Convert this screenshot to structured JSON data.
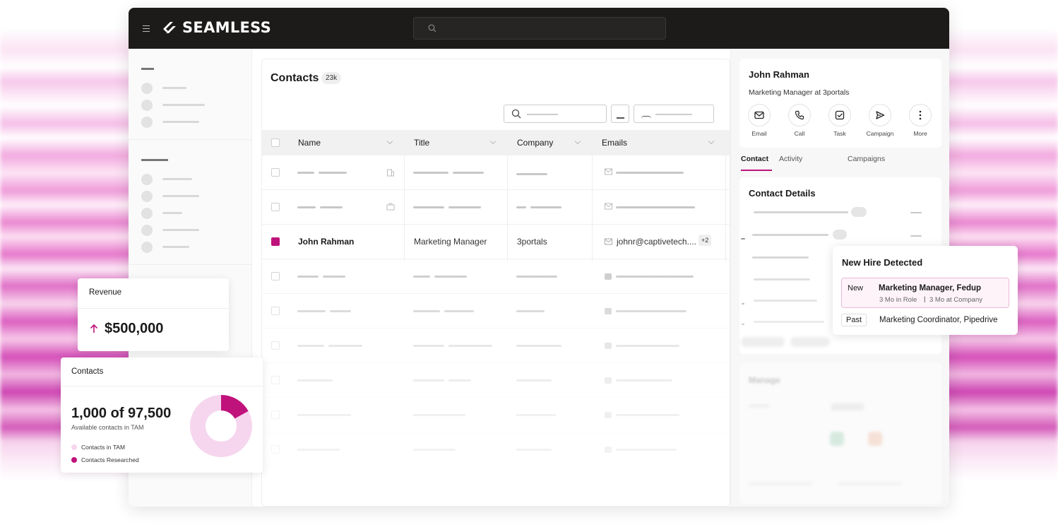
{
  "brand": {
    "name": "SEAMLESS",
    "accent": "#c0127b"
  },
  "topbar": {
    "search_icon": "search-icon",
    "menu_icon": "hamburger-icon"
  },
  "contacts_table": {
    "title": "Contacts",
    "count_badge": "23k",
    "columns": [
      "Name",
      "Title",
      "Company",
      "Emails"
    ],
    "highlighted_row": {
      "name": "John Rahman",
      "title": "Marketing Manager",
      "company": "3portals",
      "email": "johnr@captivetech....",
      "email_extra": "+2",
      "selected": true
    }
  },
  "profile": {
    "name": "John Rahman",
    "subtitle": "Marketing Manager at 3portals",
    "actions": [
      {
        "label": "Email",
        "icon": "mail-icon"
      },
      {
        "label": "Call",
        "icon": "phone-icon"
      },
      {
        "label": "Task",
        "icon": "task-check-icon"
      },
      {
        "label": "Campaign",
        "icon": "send-icon"
      },
      {
        "label": "More",
        "icon": "more-vertical-icon"
      }
    ],
    "tabs": [
      "Contact",
      "Activity",
      "Campaigns"
    ],
    "active_tab": "Contact"
  },
  "contact_details": {
    "title": "Contact Details"
  },
  "manage": {
    "title": "Manage"
  },
  "new_hire": {
    "title": "New Hire Detected",
    "new_tag": "New",
    "new_role": "Marketing Manager, Fedup",
    "new_meta_role": "3 Mo in Role",
    "new_meta_sep": "|",
    "new_meta_company": "3 Mo at Company",
    "past_tag": "Past",
    "past_role": "Marketing Coordinator, Pipedrive"
  },
  "revenue_card": {
    "label": "Revenue",
    "value": "$500,000",
    "trend": "up"
  },
  "contacts_card": {
    "label": "Contacts",
    "value": "1,000 of 97,500",
    "subtitle": "Available contacts in TAM",
    "legend": [
      {
        "label": "Contacts in TAM",
        "color": "#f6d6ee"
      },
      {
        "label": "Contacts Researched",
        "color": "#c0127b"
      }
    ],
    "donut_fraction_researched": 0.17
  }
}
